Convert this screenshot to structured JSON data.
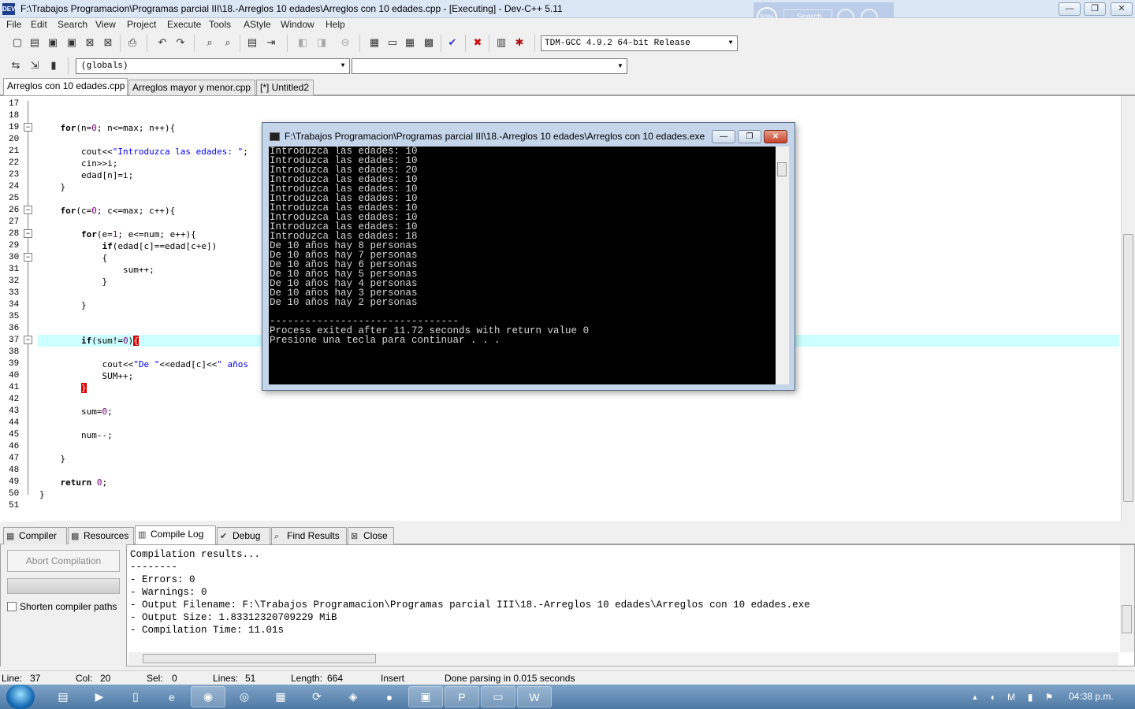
{
  "window": {
    "title": "F:\\Trabajos Programacion\\Programas parcial III\\18.-Arreglos 10 edades\\Arreglos con 10 edades.cpp - [Executing] - Dev-C++ 5.11",
    "icon": "dev-cpp-logo",
    "controls": {
      "minimize": "—",
      "maximize": "❐",
      "close": "✕"
    }
  },
  "zoom_widget": {
    "percent": "50%",
    "search_placeholder": "Search"
  },
  "menu": [
    "File",
    "Edit",
    "Search",
    "View",
    "Project",
    "Execute",
    "Tools",
    "AStyle",
    "Window",
    "Help"
  ],
  "toolbar": {
    "compiler": "TDM-GCC 4.9.2 64-bit Release",
    "scope": "(globals)",
    "function": ""
  },
  "editor_tabs": [
    "Arreglos con 10 edades.cpp",
    "Arreglos mayor y menor.cpp",
    "[*] Untitled2"
  ],
  "editor": {
    "line_numbers": [
      "17",
      "18",
      "19",
      "20",
      "21",
      "22",
      "23",
      "24",
      "25",
      "26",
      "27",
      "28",
      "29",
      "30",
      "31",
      "32",
      "33",
      "34",
      "35",
      "36",
      "37",
      "38",
      "39",
      "40",
      "41",
      "42",
      "43",
      "44",
      "45",
      "46",
      "47",
      "48",
      "49",
      "50",
      "51"
    ],
    "current_line": "37"
  },
  "console": {
    "title": "F:\\Trabajos Programacion\\Programas parcial III\\18.-Arreglos 10 edades\\Arreglos con 10 edades.exe",
    "output": "Introduzca las edades: 10\nIntroduzca las edades: 10\nIntroduzca las edades: 20\nIntroduzca las edades: 10\nIntroduzca las edades: 10\nIntroduzca las edades: 10\nIntroduzca las edades: 10\nIntroduzca las edades: 10\nIntroduzca las edades: 10\nIntroduzca las edades: 18\nDe 10 años hay 8 personas\nDe 10 años hay 7 personas\nDe 10 años hay 6 personas\nDe 10 años hay 5 personas\nDe 10 años hay 4 personas\nDe 10 años hay 3 personas\nDe 10 años hay 2 personas\n\n--------------------------------\nProcess exited after 11.72 seconds with return value 0\nPresione una tecla para continuar . . ."
  },
  "bottom_tabs": [
    "Compiler",
    "Resources",
    "Compile Log",
    "Debug",
    "Find Results",
    "Close"
  ],
  "bottom_panel": {
    "abort_label": "Abort Compilation",
    "shorten_label": "Shorten compiler paths",
    "log": "Compilation results...\n--------\n- Errors: 0\n- Warnings: 0\n- Output Filename: F:\\Trabajos Programacion\\Programas parcial III\\18.-Arreglos 10 edades\\Arreglos con 10 edades.exe\n- Output Size: 1.83312320709229 MiB\n- Compilation Time: 11.01s"
  },
  "status": {
    "line_label": "Line:",
    "line": "37",
    "col_label": "Col:",
    "col": "20",
    "sel_label": "Sel:",
    "sel": "0",
    "lines_label": "Lines:",
    "lines": "51",
    "length_label": "Length:",
    "length": "664",
    "mode": "Insert",
    "message": "Done parsing in 0.015 seconds"
  },
  "taskbar": {
    "clock": "04:38 p.m."
  }
}
